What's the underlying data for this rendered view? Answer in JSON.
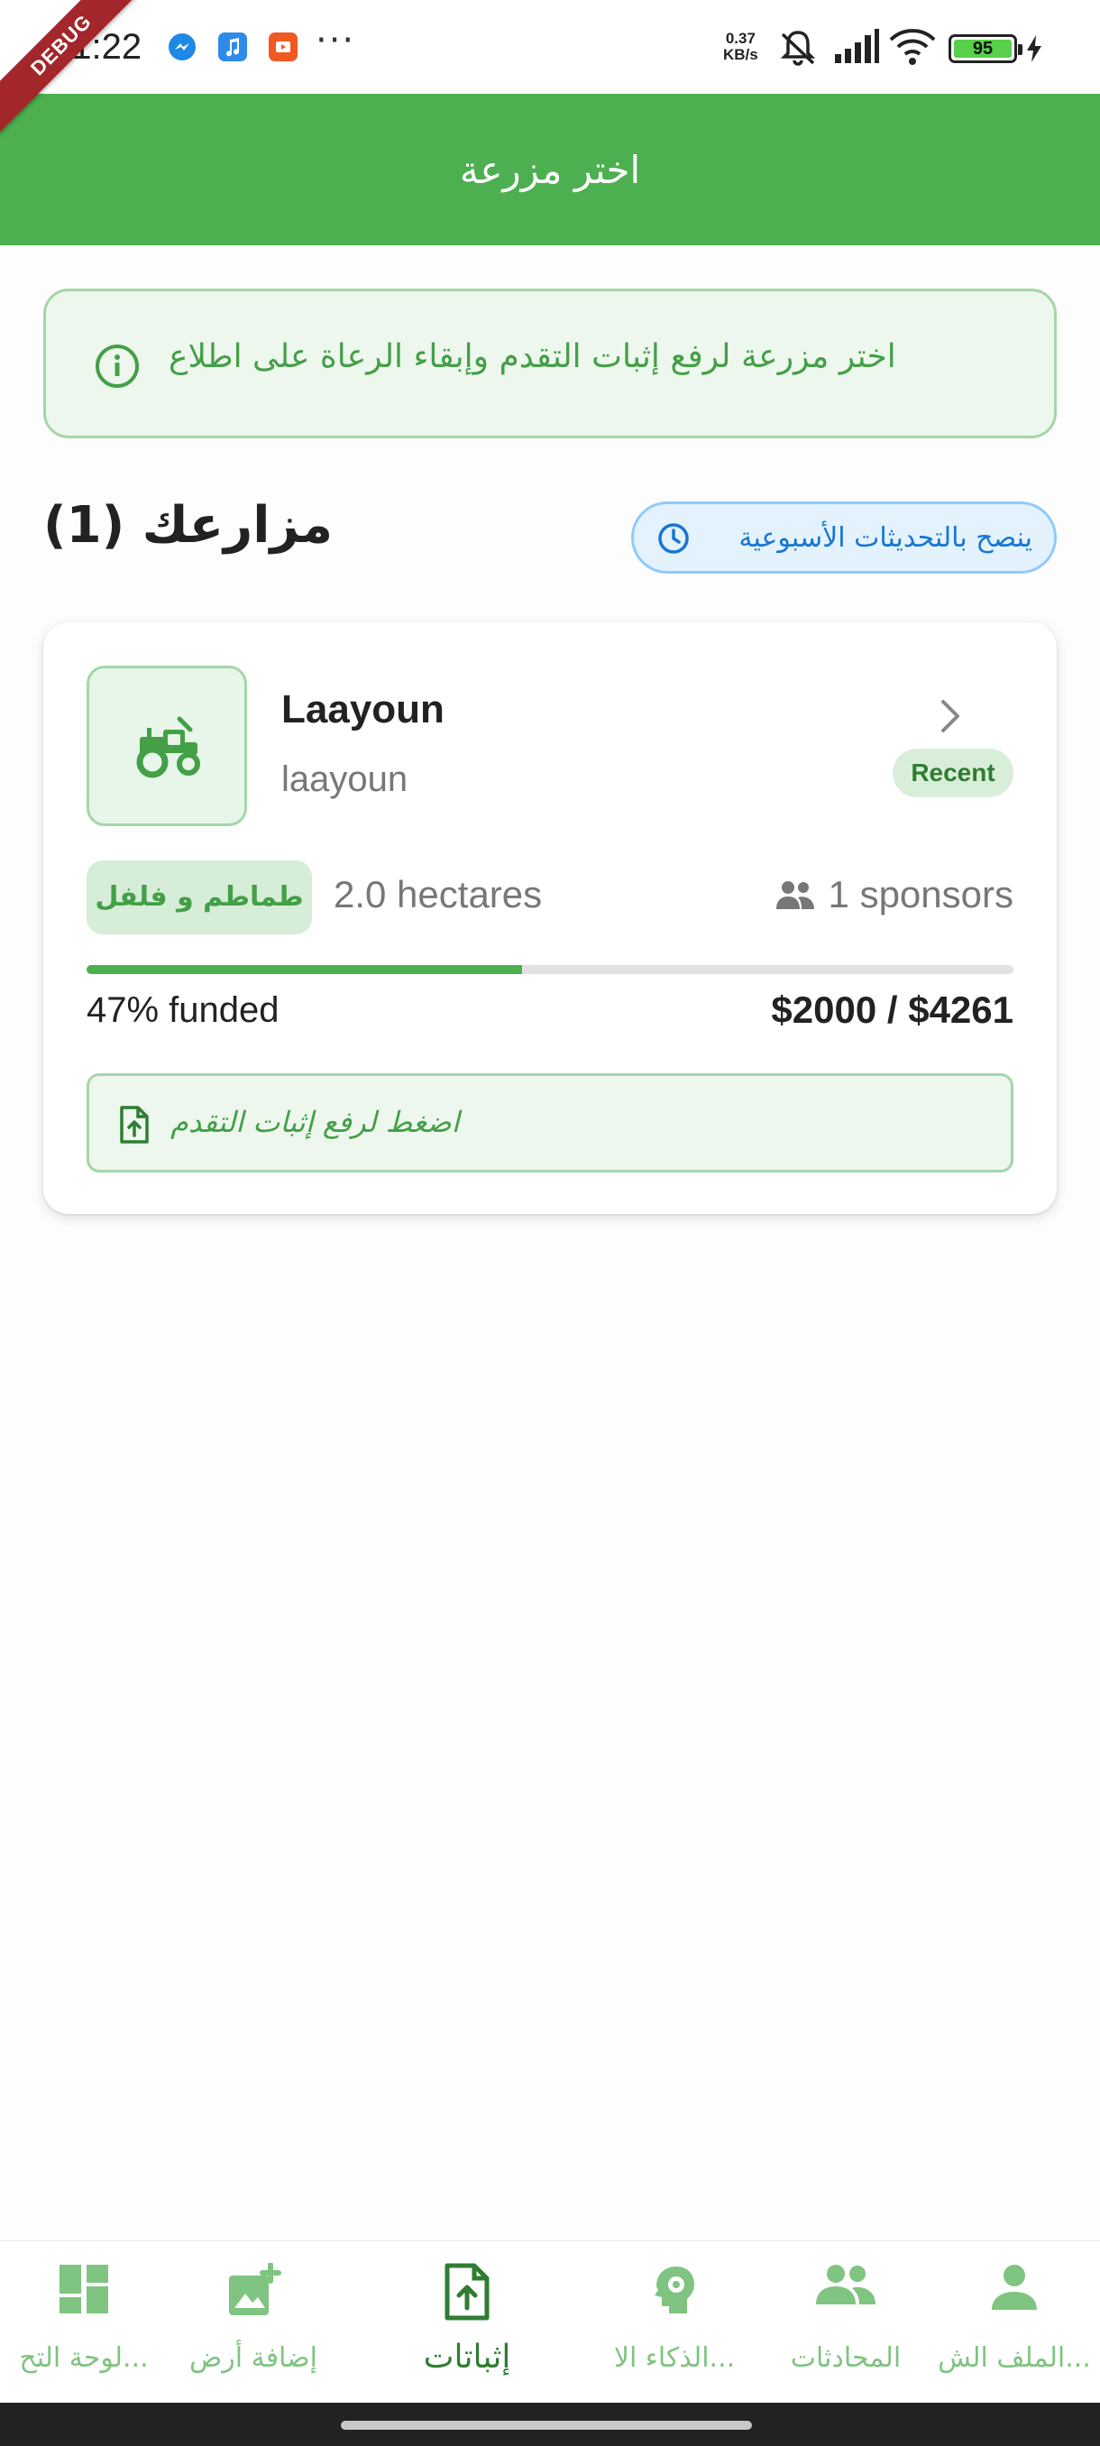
{
  "status_bar": {
    "time": "11:22",
    "net_speed_value": "0.37",
    "net_speed_unit": "KB/s",
    "battery_level": "95",
    "more_indicator": "···",
    "debug_label": "DEBUG"
  },
  "app_bar": {
    "title": "اختر مزرعة"
  },
  "info_banner": {
    "text": "اختر مزرعة لرفع إثبات التقدم وإبقاء الرعاة على اطلاع",
    "icon": "info-icon"
  },
  "section": {
    "title": "مزارعك (1)",
    "weekly_chip": "ينصح بالتحديثات الأسبوعية"
  },
  "farm": {
    "name": "Laayoun",
    "location": "laayoun",
    "badge": "Recent",
    "crop": "طماطم و فلفل",
    "area": "2.0 hectares",
    "sponsors": "1 sponsors",
    "funded_fraction": 0.47,
    "funded_label": "47% funded",
    "amount": "$2000 / $4261",
    "upload_cta": "اضغط لرفع إثبات التقدم",
    "icon": "tractor-icon"
  },
  "bottom_nav": {
    "items": [
      {
        "label": "...لوحة التح",
        "icon": "dashboard-icon"
      },
      {
        "label": "إضافة أرض",
        "icon": "add-image-icon"
      },
      {
        "label": "إثباتات",
        "icon": "upload-file-icon",
        "active": true
      },
      {
        "label": "...الذكاء الا",
        "icon": "ai-brain-icon"
      },
      {
        "label": "المحادثات",
        "icon": "people-icon"
      },
      {
        "label": "...الملف الش",
        "icon": "person-icon"
      }
    ]
  },
  "colors": {
    "primary": "#4caf50",
    "primary_dark": "#2e7d32",
    "light_green": "#eef7ee",
    "border_green": "#a5d6a7",
    "info_blue": "#1976d2",
    "chip_blue_bg": "#e3f2fd"
  }
}
